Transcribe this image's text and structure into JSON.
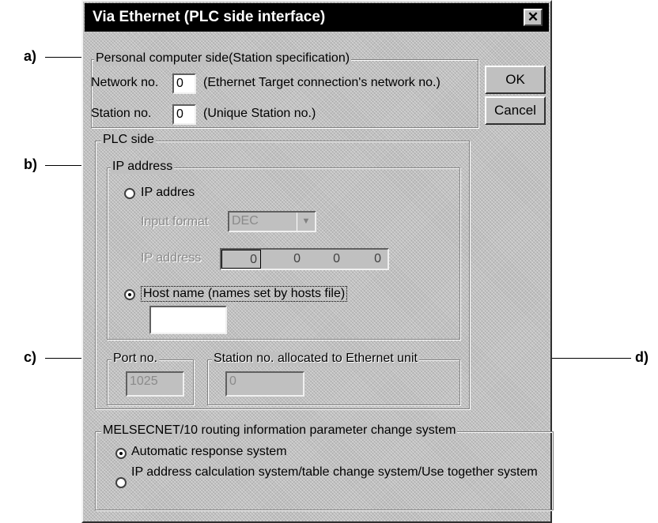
{
  "dialog": {
    "title": "Via Ethernet (PLC side interface)",
    "close_glyph": "✕",
    "ok_label": "OK",
    "cancel_label": "Cancel"
  },
  "pc_side": {
    "legend": "Personal computer side(Station specification)",
    "network_label": "Network no.",
    "network_value": "0",
    "network_desc": "(Ethernet Target connection's network no.)",
    "station_label": "Station no.",
    "station_value": "0",
    "station_desc": "(Unique Station no.)"
  },
  "plc_side": {
    "legend": "PLC side",
    "ip_group_legend": "IP address",
    "ip_radio_label": "IP addres",
    "input_format_label": "Input format",
    "input_format_value": "DEC",
    "ip_address_label": "IP address",
    "ip_octets": [
      "0",
      "0",
      "0",
      "0"
    ],
    "host_radio_label": "Host name (names set by hosts file)",
    "host_value": "",
    "port_legend": "Port no.",
    "port_value": "1025",
    "station_alloc_legend": "Station no. allocated to Ethernet unit",
    "station_alloc_value": "0"
  },
  "melsecnet": {
    "legend": "MELSECNET/10 routing information parameter change system",
    "auto_label": "Automatic response system",
    "ip_calc_label": "IP address calculation system/table change system/Use together system"
  },
  "annotations": {
    "a": "a)",
    "b": "b)",
    "c": "c)",
    "d": "d)"
  }
}
